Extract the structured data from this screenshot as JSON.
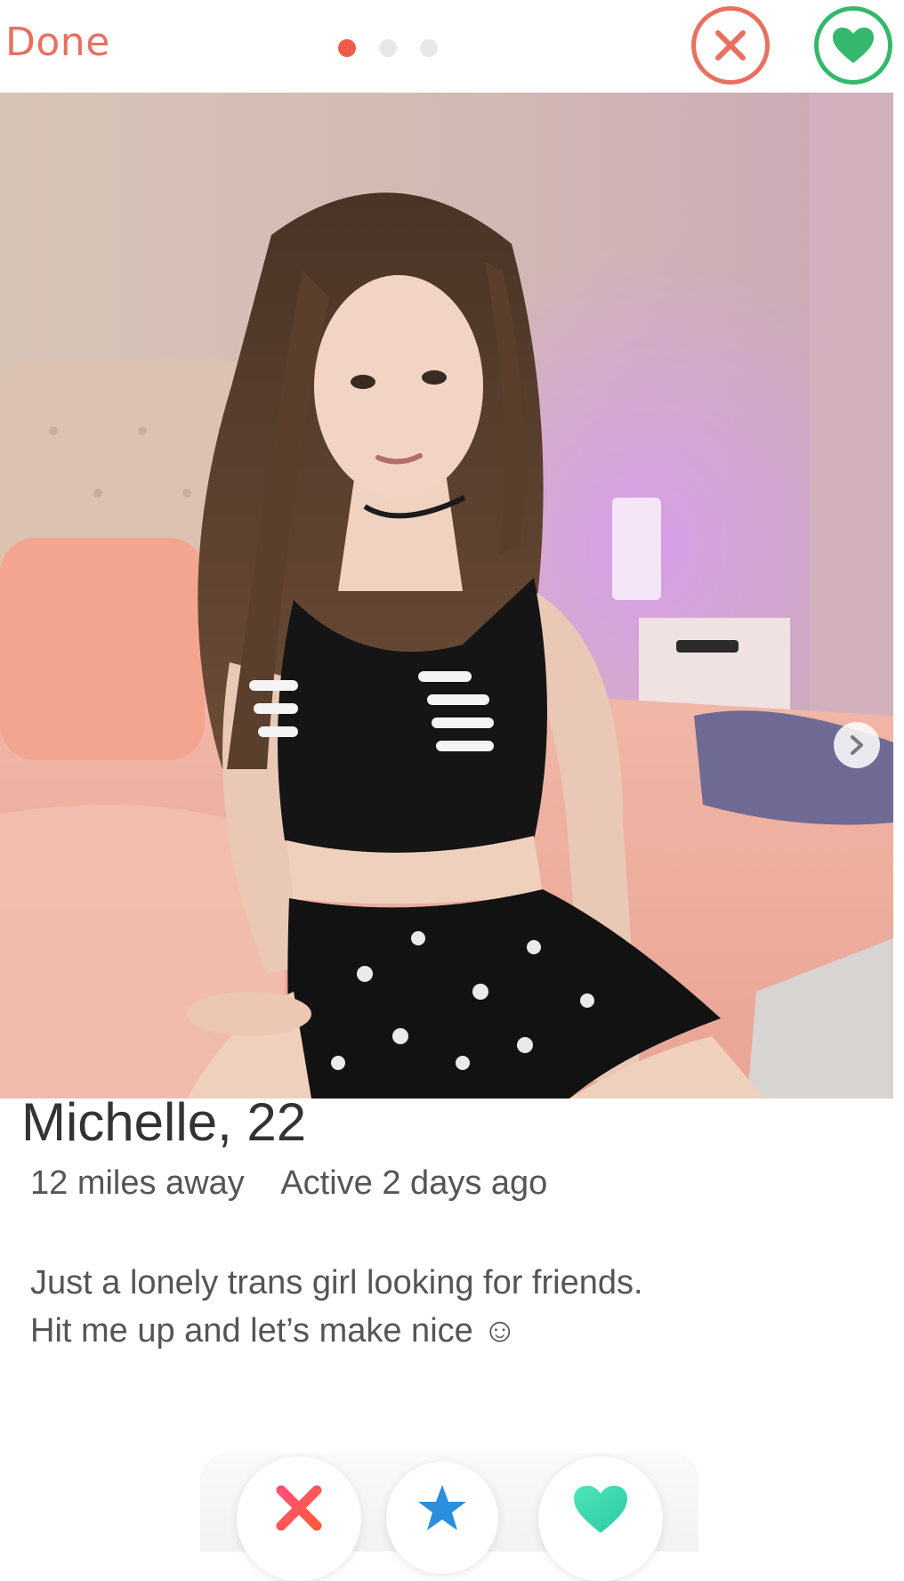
{
  "header": {
    "done_label": "Done",
    "photo_count": 3,
    "active_photo_index": 0,
    "pass_icon": "close-circle-icon",
    "like_icon": "heart-circle-icon"
  },
  "profile": {
    "name_age": "Michelle, 22",
    "distance": "12 miles away",
    "activity": "Active 2 days ago",
    "bio_line_1": "Just a lonely trans girl looking for friends.",
    "bio_line_2": "Hit me up and let’s make nice ☺"
  },
  "actions": {
    "nope_icon": "x-icon",
    "super_like_icon": "star-icon",
    "like_icon": "heart-icon"
  },
  "colors": {
    "pass_red": "#e8705f",
    "like_green": "#34b86d",
    "active_dot": "#ef5b4a",
    "star_blue": "#2a8fdd",
    "heart_teal": "#3fd9b0"
  }
}
